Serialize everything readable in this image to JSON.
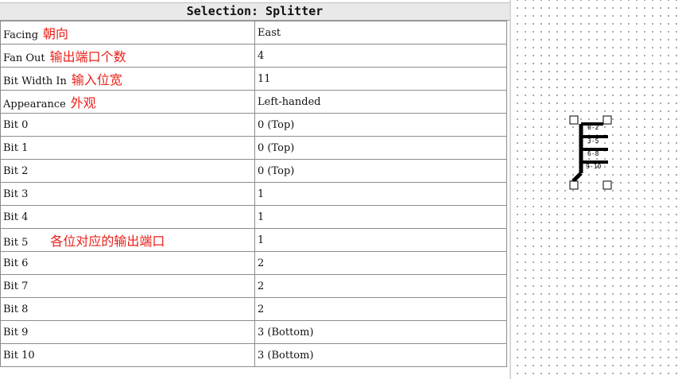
{
  "panel": {
    "title": "Selection: Splitter",
    "rows": [
      {
        "key": "Facing",
        "value": "East",
        "note": "朝向"
      },
      {
        "key": "Fan Out",
        "value": "4",
        "note": "输出端口个数"
      },
      {
        "key": "Bit Width In",
        "value": "11",
        "note": "输入位宽"
      },
      {
        "key": "Appearance",
        "value": "Left-handed",
        "note": "外观"
      },
      {
        "key": "Bit 0",
        "value": "0 (Top)"
      },
      {
        "key": "Bit 1",
        "value": "0 (Top)"
      },
      {
        "key": "Bit 2",
        "value": "0 (Top)"
      },
      {
        "key": "Bit 3",
        "value": "1"
      },
      {
        "key": "Bit 4",
        "value": "1"
      },
      {
        "key": "Bit 5",
        "value": "1",
        "note": "各位对应的输出端口"
      },
      {
        "key": "Bit 6",
        "value": "2"
      },
      {
        "key": "Bit 7",
        "value": "2"
      },
      {
        "key": "Bit 8",
        "value": "2"
      },
      {
        "key": "Bit 9",
        "value": "3 (Bottom)"
      },
      {
        "key": "Bit 10",
        "value": "3 (Bottom)"
      }
    ]
  },
  "canvas": {
    "splitter": {
      "outputs": [
        "0-2",
        "3-5",
        "6-8",
        "9-10"
      ]
    }
  }
}
